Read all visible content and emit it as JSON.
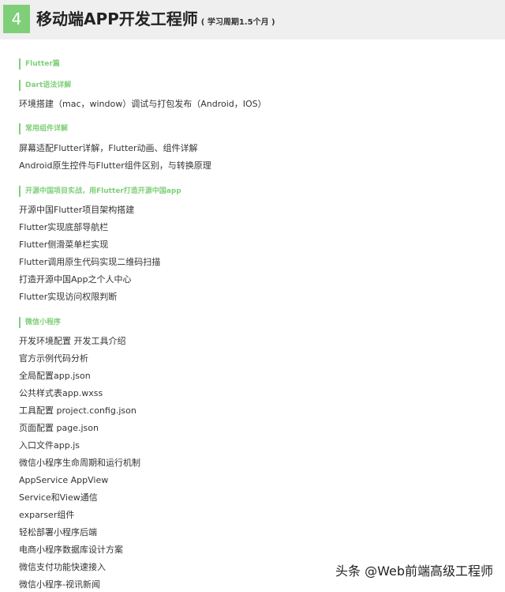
{
  "header": {
    "number": "4",
    "title": "移动端APP开发工程师",
    "subtitle": "( 学习周期1.5个月 )"
  },
  "sections": {
    "flutter": "Flutter篇",
    "dart": "Dart语法详解",
    "widgets": "常用组件详解",
    "oschina": "开源中国项目实战，用Flutter打造开源中国app",
    "wechat": "微信小程序"
  },
  "items": {
    "dart": [
      "环境搭建（mac，window）调试与打包发布（Android，IOS）"
    ],
    "widgets": [
      "屏幕适配Flutter详解，Flutter动画、组件详解",
      "Android原生控件与Flutter组件区别，与转换原理"
    ],
    "oschina": [
      "开源中国Flutter项目架构搭建",
      "Flutter实现底部导航栏",
      "Flutter侧滑菜单栏实现",
      "Flutter调用原生代码实现二维码扫描",
      "打造开源中国App之个人中心",
      "Flutter实现访问权限判断"
    ],
    "wechat": [
      "开发环境配置 开发工具介绍",
      "官方示例代码分析",
      "全局配置app.json",
      "公共样式表app.wxss",
      "工具配置 project.config.json",
      "页面配置 page.json",
      "入口文件app.js",
      "微信小程序生命周期和运行机制",
      "AppService AppView",
      "Service和View通信",
      "exparser组件",
      "轻松部署小程序后端",
      "电商小程序数据库设计方案",
      "微信支付功能快速接入",
      "微信小程序-视讯新闻"
    ]
  },
  "watermark": "头条 @Web前端高级工程师",
  "colors": {
    "accent": "#7fcf79",
    "header_bg": "#efefef"
  }
}
